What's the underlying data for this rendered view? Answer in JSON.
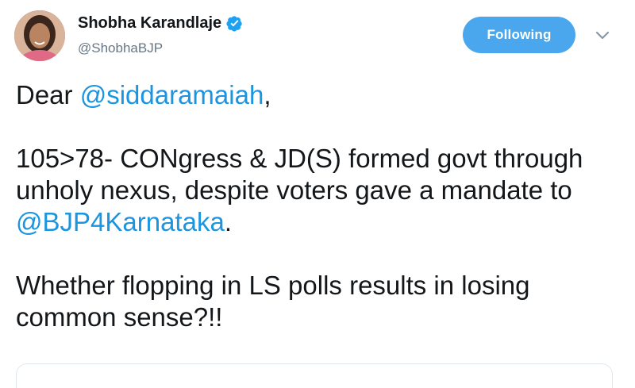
{
  "author": {
    "name": "Shobha Karandlaje",
    "handle": "@ShobhaBJP",
    "verified_icon": "verified-badge-icon",
    "avatar_icon": "avatar-photo"
  },
  "actions": {
    "follow_label": "Following",
    "menu_icon": "chevron-down-icon"
  },
  "tweet": {
    "greeting_prefix": "Dear ",
    "greeting_mention": "@siddaramaiah",
    "greeting_suffix": ",",
    "line2": "105>78- CONgress & JD(S) formed govt through unholy nexus, despite voters gave a mandate to ",
    "line2_mention": "@BJP4Karnataka",
    "line2_suffix": ".",
    "line3": "Whether flopping in LS polls results in losing common sense?!!"
  },
  "colors": {
    "accent": "#1b95e0",
    "button": "#4aa6ed",
    "secondary_text": "#657786"
  }
}
